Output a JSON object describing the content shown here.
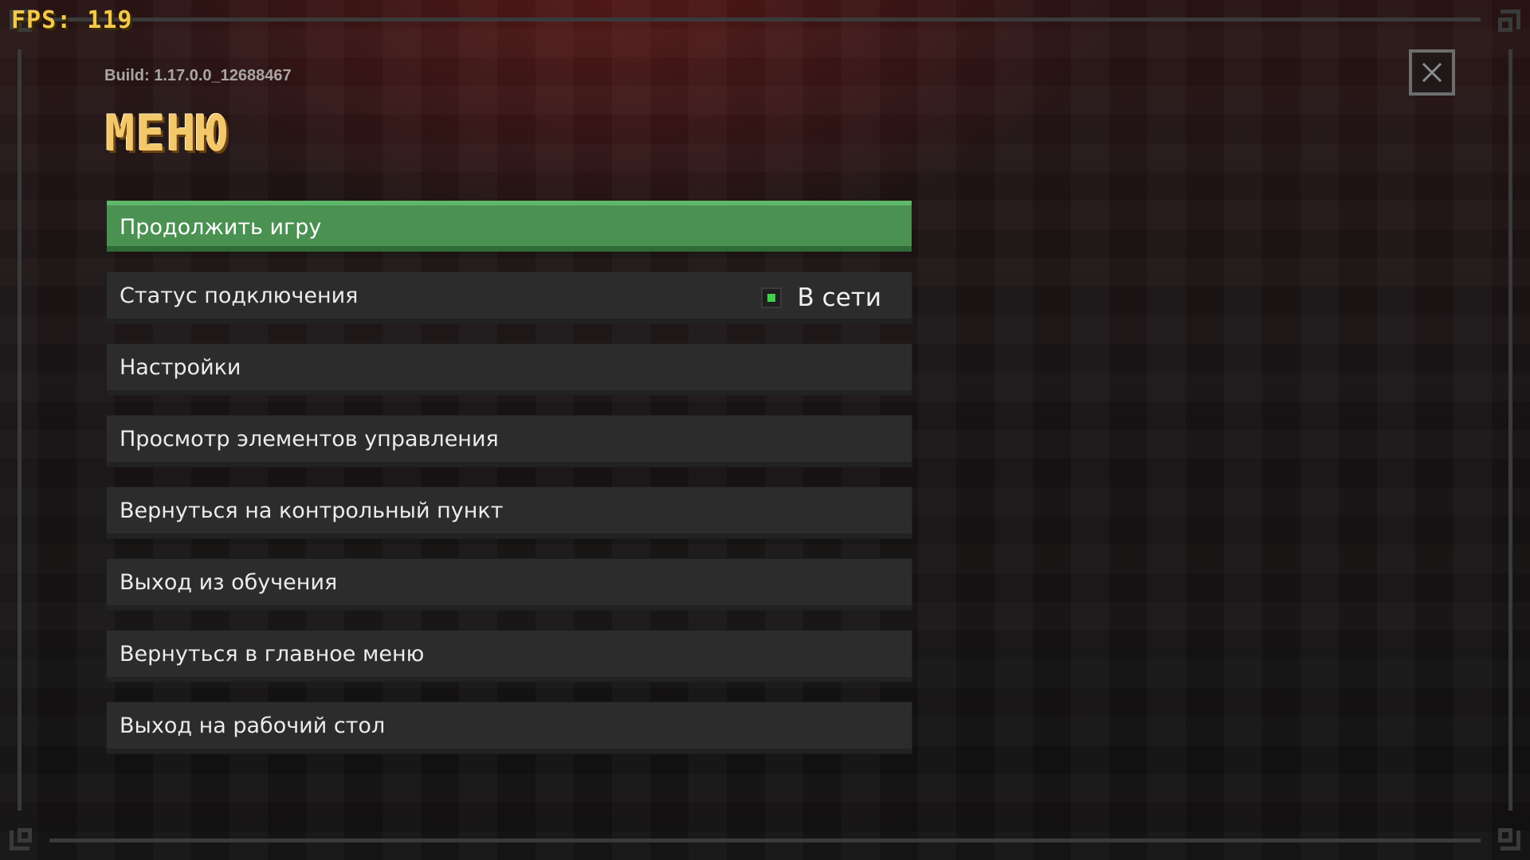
{
  "hud": {
    "fps": "FPS: 119"
  },
  "header": {
    "build": "Build: 1.17.0.0_12688467",
    "title": "МЕНЮ"
  },
  "menu": {
    "items": [
      {
        "label": "Продолжить игру"
      },
      {
        "label": "Статус подключения",
        "status": "В сети",
        "status_color": "#3fd14a"
      },
      {
        "label": "Настройки"
      },
      {
        "label": "Просмотр элементов управления"
      },
      {
        "label": "Вернуться на контрольный пункт"
      },
      {
        "label": "Выход из обучения"
      },
      {
        "label": "Вернуться в главное меню"
      },
      {
        "label": "Выход на рабочий стол"
      }
    ]
  },
  "icons": {
    "close": "close-icon",
    "status": "online-status-icon"
  },
  "colors": {
    "accent": "#4a9152",
    "title": "#f3c86a",
    "fps": "#f2c94c"
  }
}
